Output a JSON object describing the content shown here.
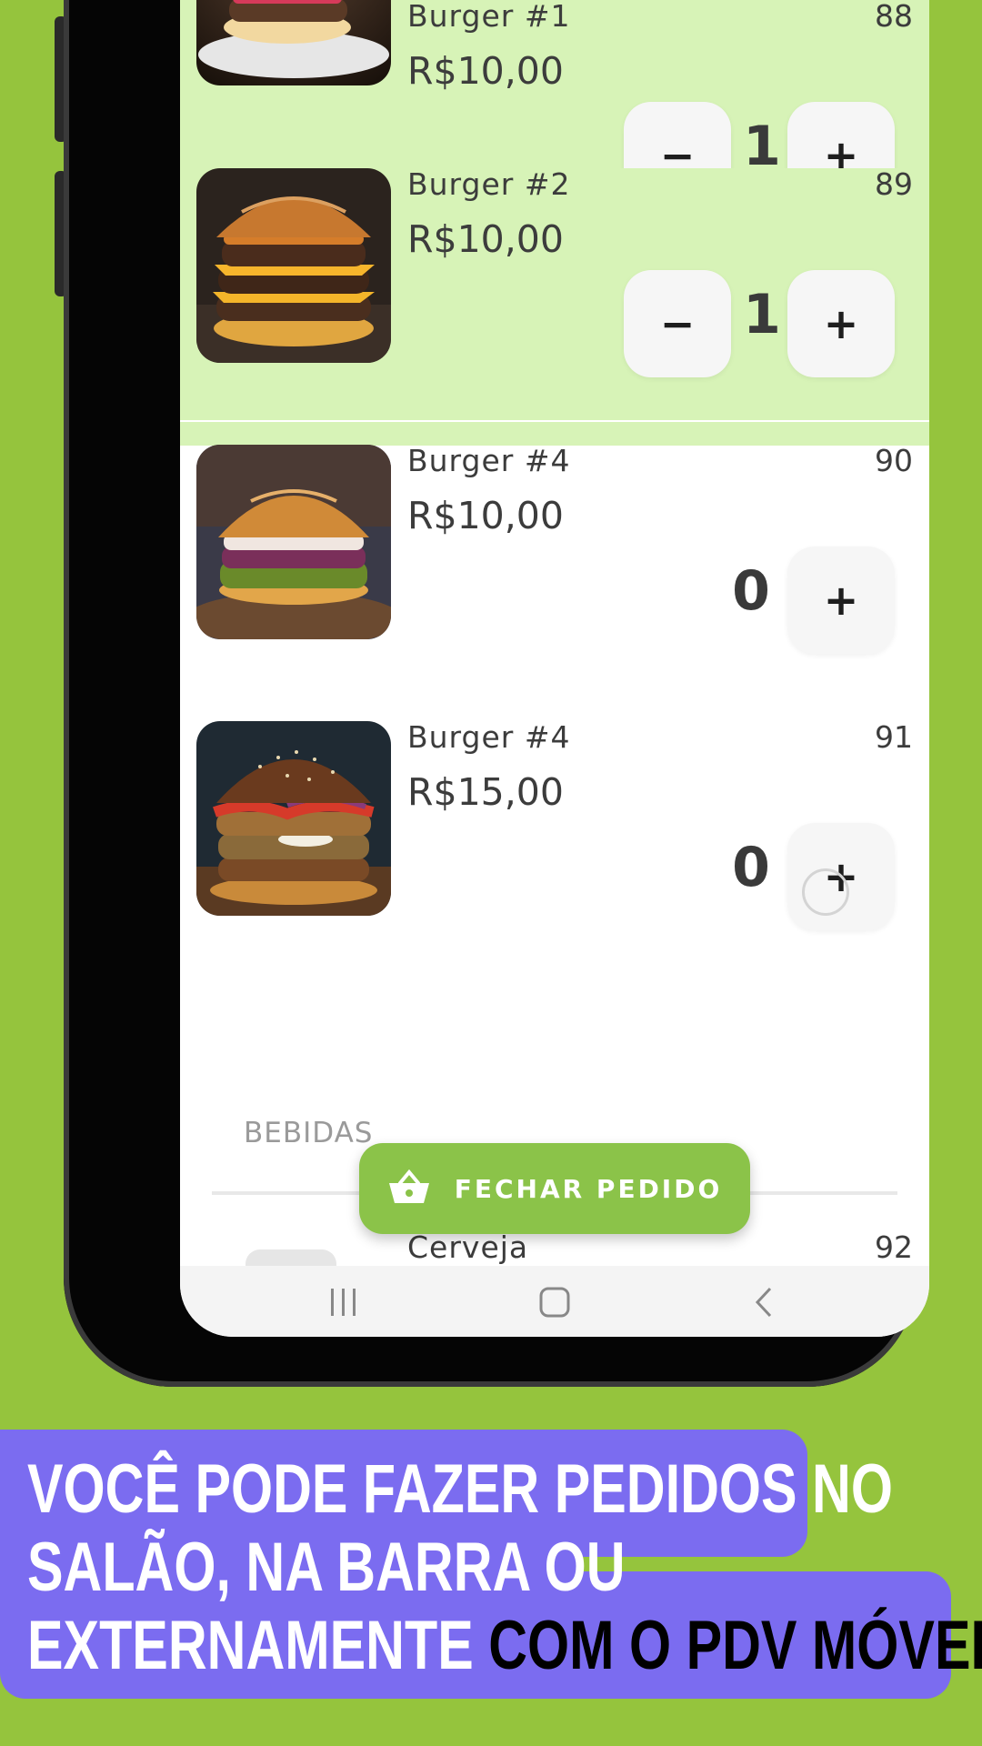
{
  "products": [
    {
      "name": "Burger #1",
      "price": "R$10,00",
      "code": "88",
      "qty": "1",
      "selected": true
    },
    {
      "name": "Burger #2",
      "price": "R$10,00",
      "code": "89",
      "qty": "1",
      "selected": true
    },
    {
      "name": "Burger #4",
      "price": "R$10,00",
      "code": "90",
      "qty": "0",
      "selected": false
    },
    {
      "name": "Burger #4",
      "price": "R$15,00",
      "code": "91",
      "qty": "0",
      "selected": false
    }
  ],
  "buttons": {
    "minus": "−",
    "plus": "+"
  },
  "section": {
    "label": "BEBIDAS"
  },
  "next_item": {
    "name": "Cerveja",
    "code": "92"
  },
  "fab": {
    "label": "FECHAR PEDIDO",
    "icon": "basket-icon"
  },
  "nav": {
    "recents_icon": "recents-icon",
    "home_icon": "home-icon",
    "back_icon": "back-icon"
  },
  "caption": {
    "line1": "VOCÊ PODE FAZER PEDIDOS NO",
    "line2": "SALÃO, NA BARRA OU",
    "line3_white": "EXTERNAMENTE ",
    "line3_dark": "COM O PDV MÓVEL",
    "line3_end": "."
  },
  "colors": {
    "background": "#95c43d",
    "selected_row": "#d7f3b7",
    "accent": "#8bc349",
    "caption": "#7b6cf0"
  }
}
